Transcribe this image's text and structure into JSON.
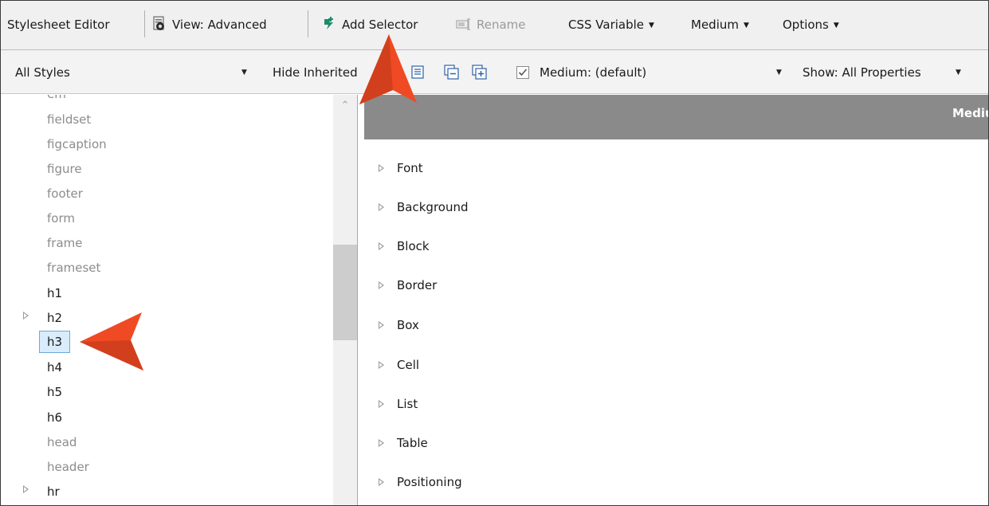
{
  "toolbar1": {
    "title": "Stylesheet Editor",
    "view_label": "View: Advanced",
    "add_selector_label": "Add Selector",
    "rename_label": "Rename",
    "css_variable_label": "CSS Variable",
    "medium_label": "Medium",
    "options_label": "Options"
  },
  "toolbar2": {
    "styles_dropdown_value": "All Styles",
    "hide_inherited_label": "Hide Inherited",
    "medium_checkbox_label": "Medium: (default)",
    "medium_checkbox_checked": true,
    "show_dropdown_value": "Show: All Properties"
  },
  "tree": {
    "items": [
      {
        "label": "em",
        "style": "muted",
        "expandable": false,
        "selected": false
      },
      {
        "label": "fieldset",
        "style": "muted",
        "expandable": false,
        "selected": false
      },
      {
        "label": "figcaption",
        "style": "muted",
        "expandable": false,
        "selected": false
      },
      {
        "label": "figure",
        "style": "muted",
        "expandable": false,
        "selected": false
      },
      {
        "label": "footer",
        "style": "muted",
        "expandable": false,
        "selected": false
      },
      {
        "label": "form",
        "style": "muted",
        "expandable": false,
        "selected": false
      },
      {
        "label": "frame",
        "style": "muted",
        "expandable": false,
        "selected": false
      },
      {
        "label": "frameset",
        "style": "muted",
        "expandable": false,
        "selected": false
      },
      {
        "label": "h1",
        "style": "strong",
        "expandable": false,
        "selected": false
      },
      {
        "label": "h2",
        "style": "strong",
        "expandable": true,
        "selected": false
      },
      {
        "label": "h3",
        "style": "strong",
        "expandable": false,
        "selected": true
      },
      {
        "label": "h4",
        "style": "strong",
        "expandable": false,
        "selected": false
      },
      {
        "label": "h5",
        "style": "strong",
        "expandable": false,
        "selected": false
      },
      {
        "label": "h6",
        "style": "strong",
        "expandable": false,
        "selected": false
      },
      {
        "label": "head",
        "style": "muted",
        "expandable": false,
        "selected": false
      },
      {
        "label": "header",
        "style": "muted",
        "expandable": false,
        "selected": false
      },
      {
        "label": "hr",
        "style": "strong",
        "expandable": true,
        "selected": false
      }
    ]
  },
  "right_panel": {
    "header_title": "Mediu",
    "groups": [
      "Font",
      "Background",
      "Block",
      "Border",
      "Box",
      "Cell",
      "List",
      "Table",
      "Positioning"
    ]
  },
  "colors": {
    "callout_arrow": "#ef4a23",
    "selection_fill": "#d9ecfb",
    "selection_border": "#6aa9d8",
    "panel_header": "#8a8a8a"
  }
}
